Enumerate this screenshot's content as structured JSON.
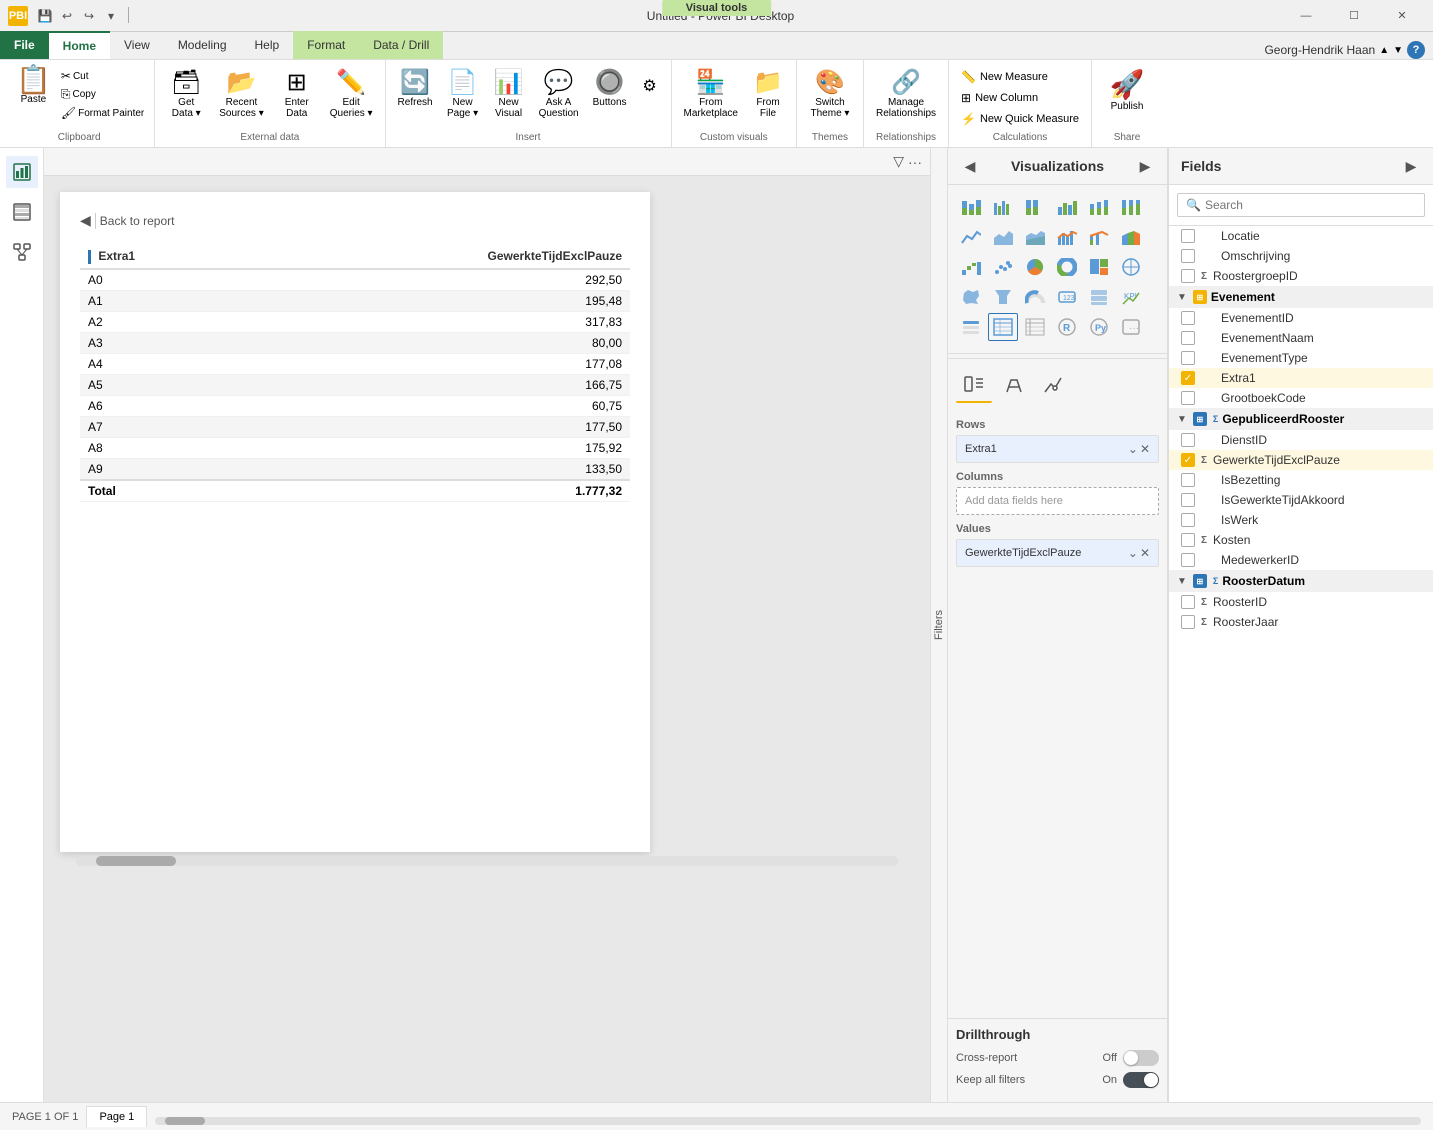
{
  "window": {
    "title": "Untitled - Power BI Desktop",
    "visualTools": "Visual tools"
  },
  "titleBar": {
    "logo": "PBI",
    "saveIcon": "💾",
    "undoIcon": "↩",
    "redoIcon": "↪",
    "dropdownIcon": "▾",
    "minimize": "—",
    "maximize": "☐",
    "close": "✕"
  },
  "ribbonTabs": {
    "file": "File",
    "home": "Home",
    "view": "View",
    "modeling": "Modeling",
    "help": "Help",
    "format": "Format",
    "dataDrill": "Data / Drill"
  },
  "ribbon": {
    "clipboard": {
      "label": "Clipboard",
      "paste": "Paste",
      "cut": "Cut",
      "copy": "Copy",
      "formatPainter": "Format Painter"
    },
    "externalData": {
      "label": "External data",
      "getData": "Get\nData",
      "recentSources": "Recent\nSources",
      "enterData": "Enter\nData",
      "editQueries": "Edit\nQueries"
    },
    "insert": {
      "label": "Insert",
      "refresh": "Refresh",
      "newPage": "New\nPage",
      "newVisual": "New\nVisual",
      "askQuestion": "Ask A\nQuestion",
      "buttons": "Buttons"
    },
    "customVisuals": {
      "label": "Custom visuals",
      "fromMarketplace": "From\nMarketplace",
      "fromFile": "From\nFile"
    },
    "themes": {
      "label": "Themes",
      "switchTheme": "Switch\nTheme"
    },
    "relationships": {
      "label": "Relationships",
      "manageRelationships": "Manage\nRelationships"
    },
    "calculations": {
      "label": "Calculations",
      "newMeasure": "New Measure",
      "newColumn": "New Column",
      "newQuickMeasure": "New Quick Measure"
    },
    "share": {
      "label": "Share",
      "publish": "Publish"
    },
    "user": "Georg-Hendrik Haan"
  },
  "canvas": {
    "backBtn": "Back to report",
    "filterIcon": "▽",
    "moreIcon": "···",
    "tableHeaders": {
      "col1": "Extra1",
      "col2": "GewerkteTijdExclPauze"
    },
    "tableRows": [
      {
        "label": "A0",
        "value": "292,50"
      },
      {
        "label": "A1",
        "value": "195,48"
      },
      {
        "label": "A2",
        "value": "317,83"
      },
      {
        "label": "A3",
        "value": "80,00"
      },
      {
        "label": "A4",
        "value": "177,08"
      },
      {
        "label": "A5",
        "value": "166,75"
      },
      {
        "label": "A6",
        "value": "60,75"
      },
      {
        "label": "A7",
        "value": "177,50"
      },
      {
        "label": "A8",
        "value": "175,92"
      },
      {
        "label": "A9",
        "value": "133,50"
      }
    ],
    "total": {
      "label": "Total",
      "value": "1.777,32"
    }
  },
  "filtersPanel": {
    "label": "Filters"
  },
  "visualizations": {
    "title": "Visualizations",
    "buildLabel": "Rows",
    "rowsField": "Extra1",
    "columnsLabel": "Columns",
    "columnsPlaceholder": "Add data fields here",
    "valuesLabel": "Values",
    "valuesField": "GewerkteTijdExclPauze",
    "drillthroughTitle": "Drillthrough",
    "crossReport": "Cross-report",
    "crossReportValue": "Off",
    "keepAllFilters": "Keep all filters",
    "keepAllFiltersValue": "On"
  },
  "fields": {
    "title": "Fields",
    "searchPlaceholder": "Search",
    "items": [
      {
        "type": "field",
        "name": "Locatie",
        "checked": false,
        "sigma": false
      },
      {
        "type": "field",
        "name": "Omschrijving",
        "checked": false,
        "sigma": false
      },
      {
        "type": "field",
        "name": "RoostergroepID",
        "checked": false,
        "sigma": true
      },
      {
        "type": "group",
        "name": "Evenement",
        "collapsed": false,
        "color": "yellow"
      },
      {
        "type": "field",
        "name": "EvenementID",
        "checked": false,
        "sigma": false
      },
      {
        "type": "field",
        "name": "EvenementNaam",
        "checked": false,
        "sigma": false
      },
      {
        "type": "field",
        "name": "EvenementType",
        "checked": false,
        "sigma": false
      },
      {
        "type": "field",
        "name": "Extra1",
        "checked": true,
        "sigma": false,
        "highlighted": true
      },
      {
        "type": "field",
        "name": "GrootboekCode",
        "checked": false,
        "sigma": false
      },
      {
        "type": "group",
        "name": "GepubliceerdRooster",
        "collapsed": false,
        "color": "blue"
      },
      {
        "type": "field",
        "name": "DienstID",
        "checked": false,
        "sigma": false
      },
      {
        "type": "field",
        "name": "GewerkteTijdExclPauze",
        "checked": true,
        "sigma": true,
        "highlighted": true
      },
      {
        "type": "field",
        "name": "IsBezetting",
        "checked": false,
        "sigma": false
      },
      {
        "type": "field",
        "name": "IsGewerkteTijdAkkoord",
        "checked": false,
        "sigma": false
      },
      {
        "type": "field",
        "name": "IsWerk",
        "checked": false,
        "sigma": false
      },
      {
        "type": "field",
        "name": "Kosten",
        "checked": false,
        "sigma": true
      },
      {
        "type": "field",
        "name": "MedewerkerID",
        "checked": false,
        "sigma": false
      },
      {
        "type": "group",
        "name": "RoosterDatum",
        "collapsed": false,
        "color": "blue"
      },
      {
        "type": "field",
        "name": "RoosterID",
        "checked": false,
        "sigma": true
      },
      {
        "type": "field",
        "name": "RoosterJaar",
        "checked": false,
        "sigma": true
      }
    ]
  },
  "bottomBar": {
    "pageIndicator": "PAGE 1 OF 1",
    "pageTab": "Page 1"
  },
  "leftNav": {
    "report": "📊",
    "data": "⊞",
    "model": "⊡"
  }
}
